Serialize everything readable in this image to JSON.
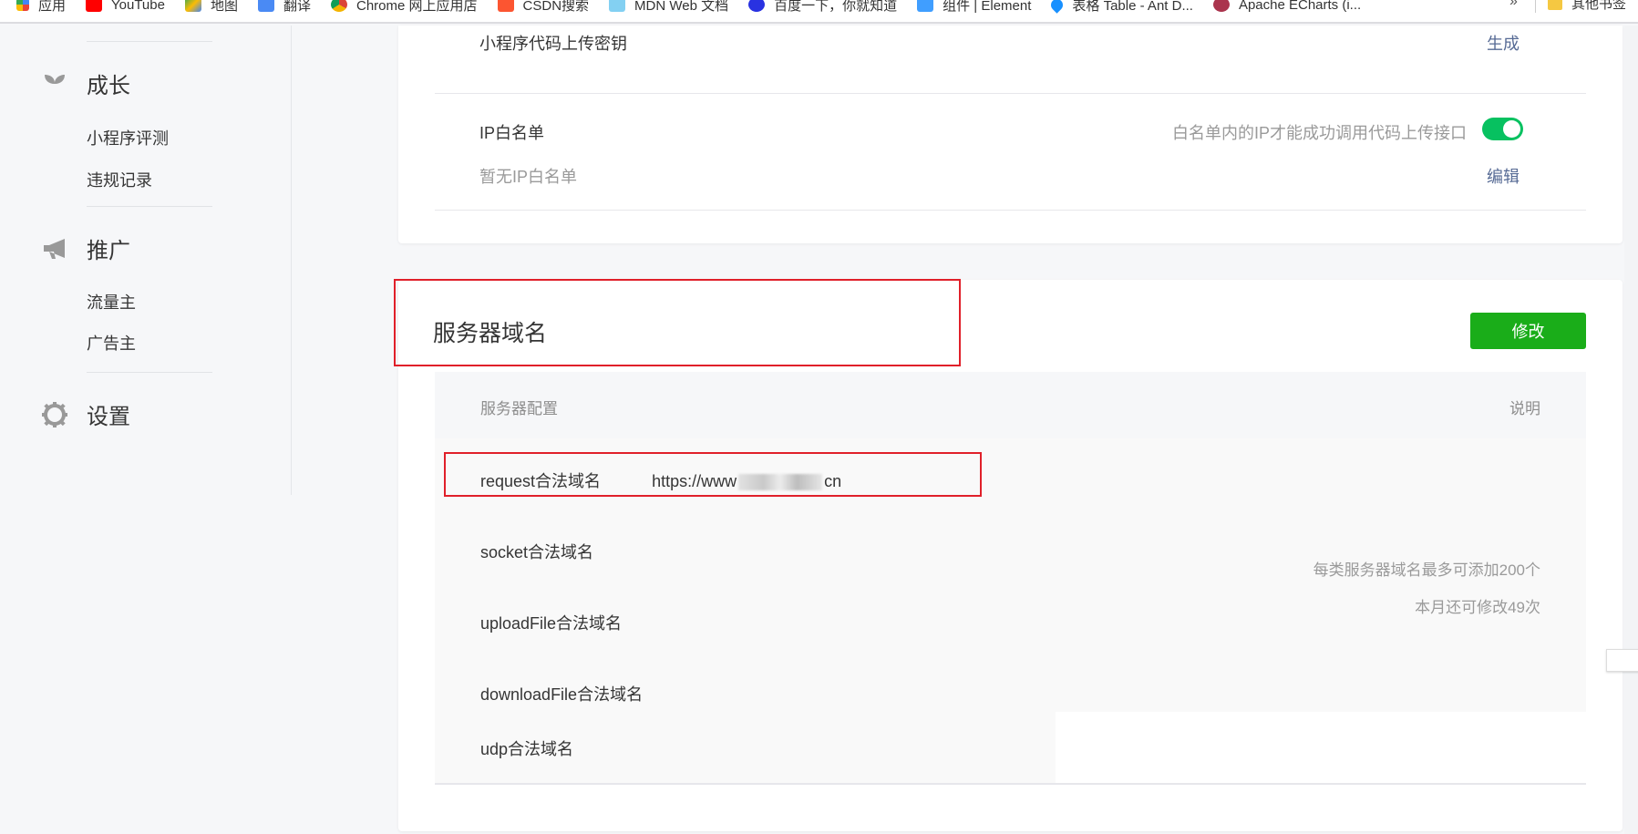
{
  "bookmarks": {
    "items": [
      {
        "label": "应用",
        "icon": "apps-grid-icon",
        "color": "#4285f4"
      },
      {
        "label": "YouTube",
        "icon": "youtube-icon",
        "color": "#ff0000"
      },
      {
        "label": "地图",
        "icon": "maps-icon",
        "color": "#34a853"
      },
      {
        "label": "翻译",
        "icon": "translate-icon",
        "color": "#4a8af4"
      },
      {
        "label": "Chrome 网上应用店",
        "icon": "chrome-webstore-icon",
        "color": "#db4437"
      },
      {
        "label": "CSDN搜索",
        "icon": "csdn-icon",
        "color": "#fc5531"
      },
      {
        "label": "MDN Web 文档",
        "icon": "mdn-icon",
        "color": "#83d0f2"
      },
      {
        "label": "百度一下，你就知道",
        "icon": "baidu-icon",
        "color": "#2932e1"
      },
      {
        "label": "组件 | Element",
        "icon": "element-icon",
        "color": "#409eff"
      },
      {
        "label": "表格 Table - Ant D...",
        "icon": "antd-icon",
        "color": "#1890ff"
      },
      {
        "label": "Apache ECharts (i...",
        "icon": "echarts-icon",
        "color": "#aa344d"
      }
    ],
    "more": "»",
    "other": "其他书签"
  },
  "sidebar": {
    "groups": [
      {
        "label": "成长",
        "icon": "sprout-icon",
        "items": [
          "小程序评测",
          "违规记录"
        ]
      },
      {
        "label": "推广",
        "icon": "megaphone-icon",
        "items": [
          "流量主",
          "广告主"
        ]
      },
      {
        "label": "设置",
        "icon": "gear-icon",
        "items": []
      }
    ]
  },
  "upload_card": {
    "secret_label": "小程序代码上传密钥",
    "secret_action": "生成",
    "ip_label": "IP白名单",
    "ip_hint": "白名单内的IP才能成功调用代码上传接口",
    "ip_toggle_on": true,
    "ip_empty": "暂无IP白名单",
    "ip_action": "编辑"
  },
  "server_card": {
    "title": "服务器域名",
    "edit_button": "修改",
    "table_head": {
      "config": "服务器配置",
      "note": "说明"
    },
    "rows": [
      {
        "label": "request合法域名",
        "value_prefix": "https://www",
        "value_suffix": "cn"
      },
      {
        "label": "socket合法域名",
        "value": ""
      },
      {
        "label": "uploadFile合法域名",
        "value": ""
      },
      {
        "label": "downloadFile合法域名",
        "value": ""
      },
      {
        "label": "udp合法域名",
        "value": ""
      }
    ],
    "notes": [
      "每类服务器域名最多可添加200个",
      "本月还可修改49次"
    ]
  },
  "colors": {
    "accent_green": "#1aad19",
    "toggle_green": "#07c160",
    "link": "#576b95",
    "highlight_red": "#e0202a"
  }
}
